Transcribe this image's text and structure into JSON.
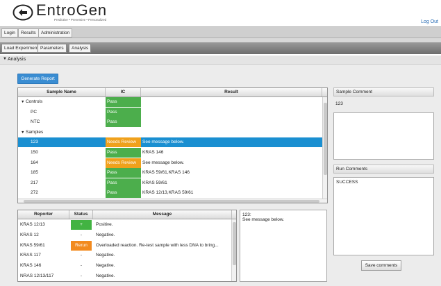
{
  "header": {
    "logo_name": "EntroGen",
    "logo_tagline": "Predictive • Preventive • Personalized",
    "logout": "Log Out"
  },
  "menu": [
    "Login",
    "Results",
    "Administration"
  ],
  "tabs": [
    "Load Experiment",
    "Parameters",
    "Analysis"
  ],
  "section": {
    "label": "Analysis",
    "chevron": "▼"
  },
  "generate_button": "Generate Report",
  "sample_table": {
    "headers": [
      "Sample Name",
      "IC",
      "Result"
    ],
    "rows": [
      {
        "kind": "group",
        "name": "Controls",
        "ic": "Pass",
        "result": ""
      },
      {
        "kind": "item",
        "name": "PC",
        "ic": "Pass",
        "result": ""
      },
      {
        "kind": "item",
        "name": "NTC",
        "ic": "Pass",
        "result": ""
      },
      {
        "kind": "group",
        "name": "Samples",
        "ic": "",
        "result": ""
      },
      {
        "kind": "item",
        "name": "123",
        "ic": "Needs Review",
        "result": "See message below.",
        "selected": true
      },
      {
        "kind": "item",
        "name": "150",
        "ic": "Pass",
        "result": "KRAS 146"
      },
      {
        "kind": "item",
        "name": "164",
        "ic": "Needs Review",
        "result": "See message below."
      },
      {
        "kind": "item",
        "name": "185",
        "ic": "Pass",
        "result": "KRAS 59/61,KRAS 146"
      },
      {
        "kind": "item",
        "name": "217",
        "ic": "Pass",
        "result": "KRAS 59/61"
      },
      {
        "kind": "item",
        "name": "272",
        "ic": "Pass",
        "result": "KRAS 12/13,KRAS 59/61"
      }
    ]
  },
  "reporter_table": {
    "headers": [
      "Reporter",
      "Status",
      "Message"
    ],
    "rows": [
      {
        "reporter": "KRAS 12/13",
        "status": "+",
        "message": "Positive."
      },
      {
        "reporter": "KRAS 12",
        "status": "-",
        "message": "Negative."
      },
      {
        "reporter": "KRAS 59/61",
        "status": "Rerun",
        "message": "Overloaded reaction.  Re-test sample with less DNA to bring..."
      },
      {
        "reporter": "KRAS 117",
        "status": "-",
        "message": "Negative."
      },
      {
        "reporter": "KRAS 146",
        "status": "-",
        "message": "Negative."
      },
      {
        "reporter": "NRAS 12/13/117",
        "status": "-",
        "message": "Negative."
      }
    ]
  },
  "detail": {
    "line1": "123:",
    "line2": "See message below."
  },
  "sample_comment": {
    "title": "Sample Comment",
    "value": "123"
  },
  "run_comments": {
    "title": "Run Comments",
    "value": "SUCCESS"
  },
  "save_button": "Save comments",
  "colors": {
    "pass": "#4cae4c",
    "review": "#f0a11c",
    "selected": "#1a8fd1",
    "rerun": "#f28a1e",
    "accent": "#3a8dd2"
  }
}
